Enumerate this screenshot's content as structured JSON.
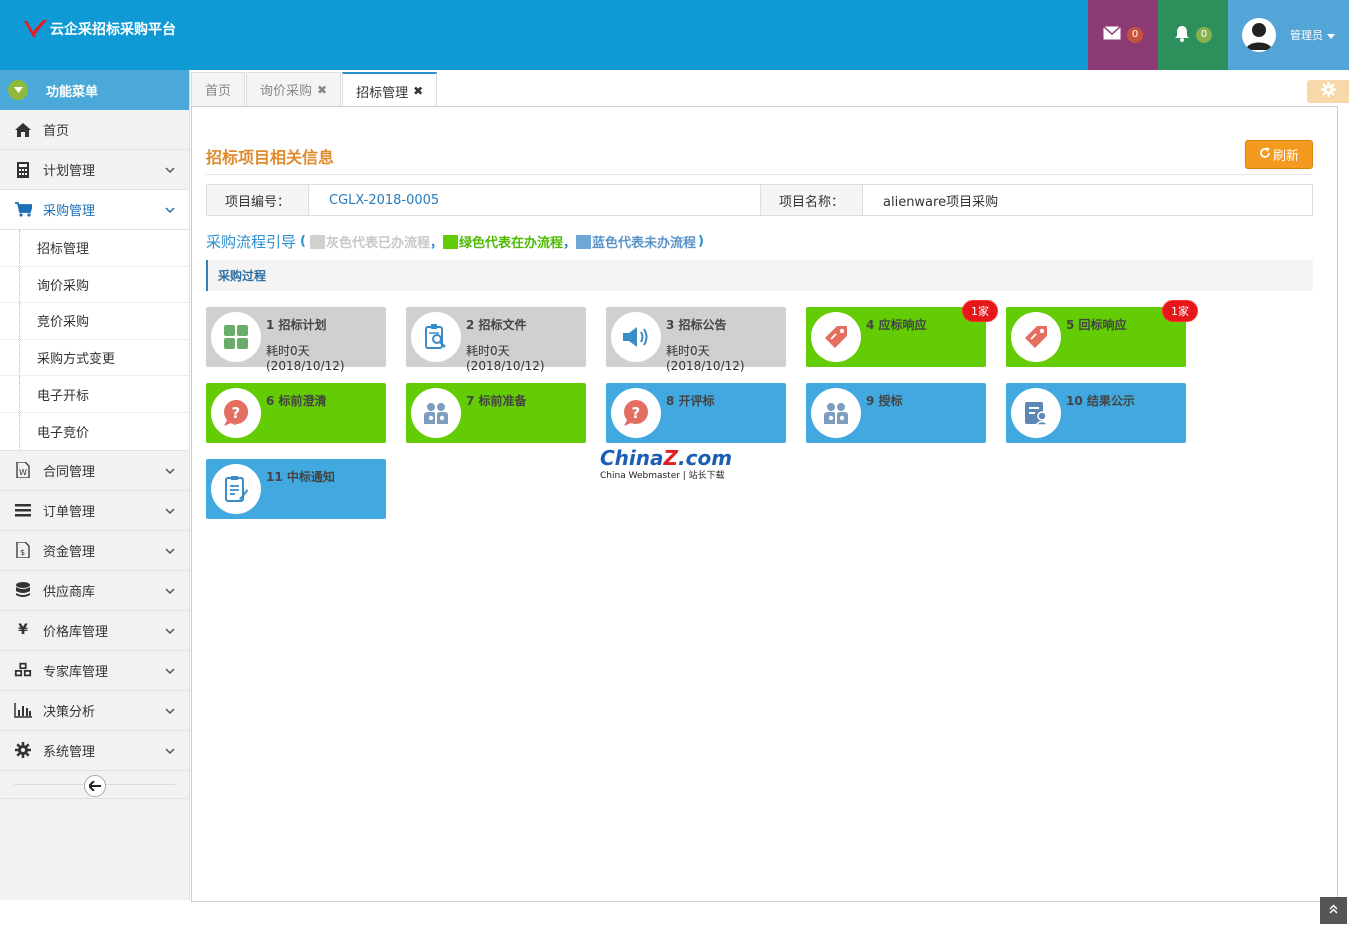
{
  "header": {
    "app_title": "云企采招标采购平台",
    "mail_count": "0",
    "notify_count": "0",
    "user_name": "管理员"
  },
  "sidebar": {
    "menu_title": "功能菜单",
    "items": [
      {
        "label": "首页",
        "icon": "home-icon"
      },
      {
        "label": "计划管理",
        "icon": "calculator-icon"
      },
      {
        "label": "采购管理",
        "icon": "cart-icon"
      },
      {
        "label": "合同管理",
        "icon": "word-doc-icon"
      },
      {
        "label": "订单管理",
        "icon": "list-icon"
      },
      {
        "label": "资金管理",
        "icon": "money-file-icon"
      },
      {
        "label": "供应商库",
        "icon": "database-icon"
      },
      {
        "label": "价格库管理",
        "icon": "yen-icon"
      },
      {
        "label": "专家库管理",
        "icon": "cubes-icon"
      },
      {
        "label": "决策分析",
        "icon": "bar-chart-icon"
      },
      {
        "label": "系统管理",
        "icon": "gear-icon"
      }
    ],
    "procurement_sub": [
      "招标管理",
      "询价采购",
      "竞价采购",
      "采购方式变更",
      "电子开标",
      "电子竞价"
    ]
  },
  "tabs": [
    {
      "label": "首页",
      "closable": false,
      "active": false
    },
    {
      "label": "询价采购",
      "closable": true,
      "active": false
    },
    {
      "label": "招标管理",
      "closable": true,
      "active": true
    }
  ],
  "main": {
    "section_title": "招标项目相关信息",
    "refresh_label": "刷新",
    "project_code_label": "项目编号：",
    "project_code": "CGLX-2018-0005",
    "project_name_label": "项目名称：",
    "project_name": "alienware项目采购",
    "guide_title": "采购流程引导",
    "guide_open": "(",
    "guide_close": ")",
    "guide_sep": "，",
    "legend_gray": "灰色代表已办流程",
    "legend_green": "绿色代表在办流程",
    "legend_blue": "蓝色代表未办流程",
    "process_label": "采购过程"
  },
  "steps": [
    {
      "title": "1 招标计划",
      "sub": "耗时0天(2018/10/12)",
      "state": "gray",
      "icon": "grid-icon",
      "badge": ""
    },
    {
      "title": "2 招标文件",
      "sub": "耗时0天(2018/10/12)",
      "state": "gray",
      "icon": "document-search-icon",
      "badge": ""
    },
    {
      "title": "3 招标公告",
      "sub": "耗时0天(2018/10/12)",
      "state": "gray",
      "icon": "speaker-icon",
      "badge": ""
    },
    {
      "title": "4 应标响应",
      "sub": "",
      "state": "green",
      "icon": "tag-icon",
      "badge": "1家"
    },
    {
      "title": "5 回标响应",
      "sub": "",
      "state": "green",
      "icon": "tag-icon",
      "badge": "1家"
    },
    {
      "title": "6 标前澄清",
      "sub": "",
      "state": "green",
      "icon": "question-icon",
      "badge": ""
    },
    {
      "title": "7 标前准备",
      "sub": "",
      "state": "green",
      "icon": "people-icon",
      "badge": ""
    },
    {
      "title": "8 开评标",
      "sub": "",
      "state": "blue",
      "icon": "question-icon",
      "badge": ""
    },
    {
      "title": "9 授标",
      "sub": "",
      "state": "blue",
      "icon": "people-icon",
      "badge": ""
    },
    {
      "title": "10 结果公示",
      "sub": "",
      "state": "blue",
      "icon": "user-card-icon",
      "badge": ""
    },
    {
      "title": "11 中标通知",
      "sub": "",
      "state": "blue",
      "icon": "clipboard-icon",
      "badge": ""
    }
  ],
  "watermark": {
    "brand_a": "China",
    "brand_z": "Z",
    "brand_b": ".com",
    "tagline": "China Webmaster | 站长下载"
  },
  "colors": {
    "header": "#0f9ad6",
    "gray_step": "#d0d1ce",
    "green_step": "#63cc04",
    "blue_step": "#41a9e0",
    "accent_orange": "#e08a2c"
  }
}
